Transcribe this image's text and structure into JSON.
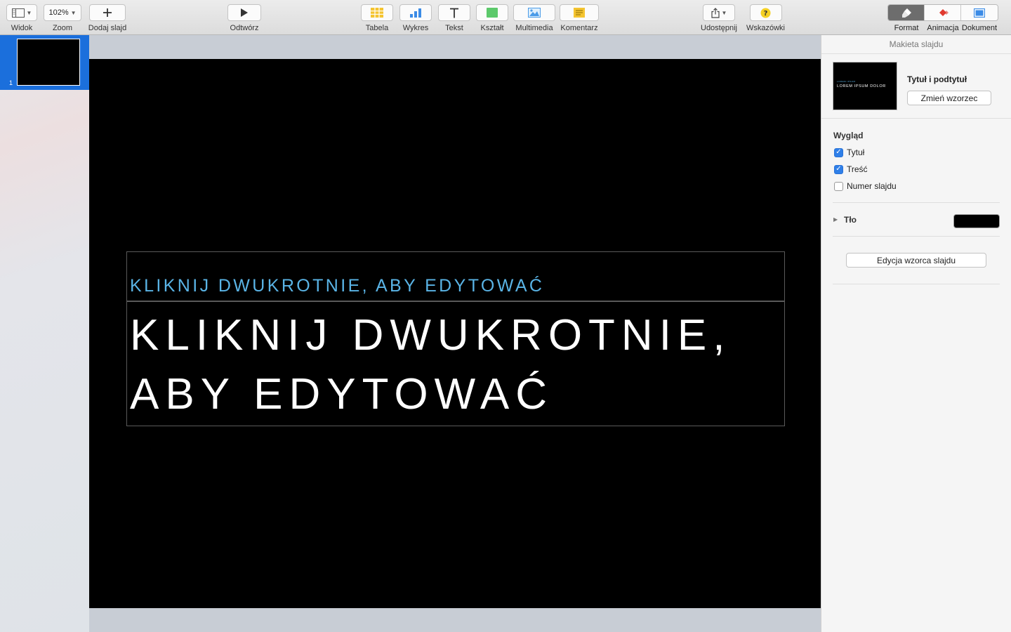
{
  "toolbar": {
    "view": {
      "label": "Widok",
      "icon": "sidebar-icon"
    },
    "zoom": {
      "label": "Zoom",
      "value": "102%"
    },
    "add_slide": {
      "label": "Dodaj slajd",
      "icon": "plus-icon"
    },
    "play": {
      "label": "Odtwórz",
      "icon": "play-icon"
    },
    "insert": [
      {
        "key": "table",
        "label": "Tabela",
        "icon": "table-icon",
        "color": "#f4c430"
      },
      {
        "key": "chart",
        "label": "Wykres",
        "icon": "chart-icon",
        "color": "#3b8be6"
      },
      {
        "key": "text",
        "label": "Tekst",
        "icon": "text-icon"
      },
      {
        "key": "shape",
        "label": "Kształt",
        "icon": "shape-icon",
        "color": "#5cc96b"
      },
      {
        "key": "media",
        "label": "Multimedia",
        "icon": "media-icon",
        "color": "#4a9be8"
      },
      {
        "key": "comment",
        "label": "Komentarz",
        "icon": "comment-icon",
        "color": "#f4c430"
      }
    ],
    "share": {
      "label": "Udostępnij",
      "icon": "share-icon"
    },
    "tips": {
      "label": "Wskazówki",
      "icon": "question-icon",
      "color": "#f4d023"
    },
    "inspector_tabs": [
      {
        "label": "Format",
        "icon": "paintbrush-icon",
        "active": true
      },
      {
        "label": "Animacja",
        "icon": "diamond-icon",
        "color": "#e0392e"
      },
      {
        "label": "Dokument",
        "icon": "document-icon",
        "color": "#3b8be6"
      }
    ]
  },
  "navigator": {
    "slides": [
      {
        "number": "1",
        "selected": true
      }
    ],
    "selection_color": "#1b6fdc"
  },
  "slide": {
    "subtitle": "KLIKNIJ DWUKROTNIE, ABY EDYTOWAĆ",
    "title": "KLIKNIJ DWUKROTNIE,\nABY EDYTOWAĆ",
    "background": "#000000",
    "subtitle_color": "#5ab4e6"
  },
  "sidebar": {
    "header": "Makieta slajdu",
    "master": {
      "name": "Tytuł i podtytuł",
      "change_button": "Zmień wzorzec",
      "thumb_small": "LOREM IPSUM",
      "thumb_title": "LOREM IPSUM DOLOR"
    },
    "look": {
      "title": "Wygląd",
      "options": [
        {
          "label": "Tytuł",
          "checked": true
        },
        {
          "label": "Treść",
          "checked": true
        },
        {
          "label": "Numer slajdu",
          "checked": false
        }
      ]
    },
    "background": {
      "label": "Tło",
      "color": "#000000"
    },
    "edit_master_button": "Edycja wzorca slajdu"
  }
}
